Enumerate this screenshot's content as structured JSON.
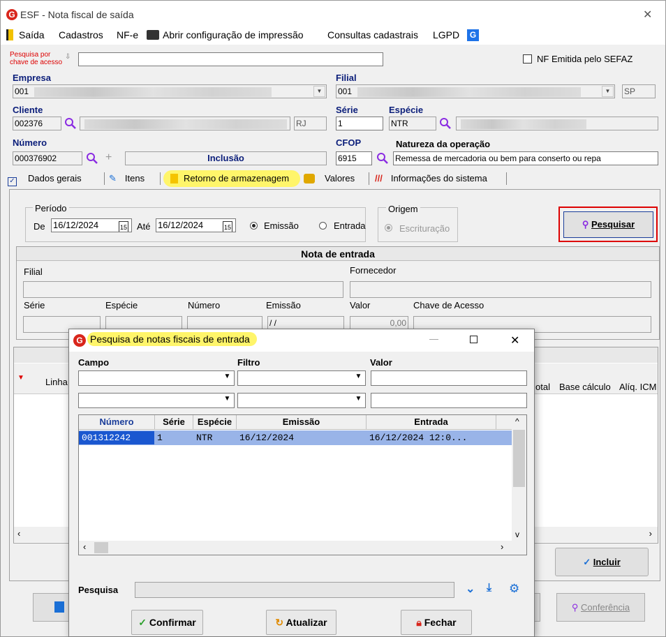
{
  "window": {
    "title": "ESF - Nota fiscal de saída",
    "close": "✕"
  },
  "menu": {
    "saida": "Saída",
    "cadastros": "Cadastros",
    "nfe": "NF-e",
    "abrir": "Abrir configuração de impressão",
    "consultas": "Consultas cadastrais",
    "lgpd": "LGPD"
  },
  "search_key": {
    "label_line1": "Pesquisa por",
    "label_line2": "chave de acesso",
    "value": ""
  },
  "nf_sefaz": {
    "label": "NF Emitida pelo SEFAZ",
    "checked": false
  },
  "empresa": {
    "label": "Empresa",
    "code": "001"
  },
  "filial": {
    "label": "Filial",
    "code": "001",
    "uf": "SP"
  },
  "cliente": {
    "label": "Cliente",
    "code": "002376",
    "uf": "RJ"
  },
  "serie": {
    "label": "Série",
    "value": "1"
  },
  "especie": {
    "label": "Espécie",
    "value": "NTR"
  },
  "numero": {
    "label": "Número",
    "value": "000376902",
    "status": "Inclusão"
  },
  "cfop": {
    "label": "CFOP",
    "value": "6915"
  },
  "natureza": {
    "label": "Natureza da operação",
    "value": "Remessa de mercadoria ou bem para conserto ou repa"
  },
  "tabs": {
    "dados": "Dados gerais",
    "itens": "Itens",
    "retorno": "Retorno de armazenagem",
    "valores": "Valores",
    "info": "Informações do sistema"
  },
  "periodo": {
    "legend": "Período",
    "de_label": "De",
    "de": "16/12/2024",
    "ate_label": "Até",
    "ate": "16/12/2024",
    "emissao": "Emissão",
    "entrada": "Entrada"
  },
  "origem": {
    "legend": "Origem",
    "escrituracao": "Escrituração"
  },
  "pesquisar": "Pesquisar",
  "nota_entrada": {
    "header": "Nota de entrada",
    "filial": "Filial",
    "fornecedor": "Fornecedor",
    "serie": "Série",
    "especie": "Espécie",
    "numero": "Número",
    "emissao": "Emissão",
    "emissao_value": "/ /",
    "valor": "Valor",
    "valor_value": "0,00",
    "chave": "Chave de Acesso"
  },
  "bg_grid": {
    "linha": "Linha",
    "total": "otal",
    "base": "Base cálculo",
    "aliq": "Alíq. ICM"
  },
  "incluir": "Incluir",
  "conferencia": "Conferência",
  "dialog": {
    "title": "Pesquisa de notas fiscais de entrada",
    "campo": "Campo",
    "filtro": "Filtro",
    "valor": "Valor",
    "columns": [
      "Número",
      "Série",
      "Espécie",
      "Emissão",
      "Entrada"
    ],
    "rows": [
      [
        "001312242",
        "1",
        "NTR",
        "16/12/2024",
        "16/12/2024 12:0..."
      ]
    ],
    "pesquisa_label": "Pesquisa",
    "confirmar": "Confirmar",
    "atualizar": "Atualizar",
    "fechar": "Fechar"
  },
  "colors": {
    "accent_blue": "#0b1e7a",
    "highlight": "#fff56a",
    "selection": "#99b4e8",
    "red": "#d9261c"
  }
}
